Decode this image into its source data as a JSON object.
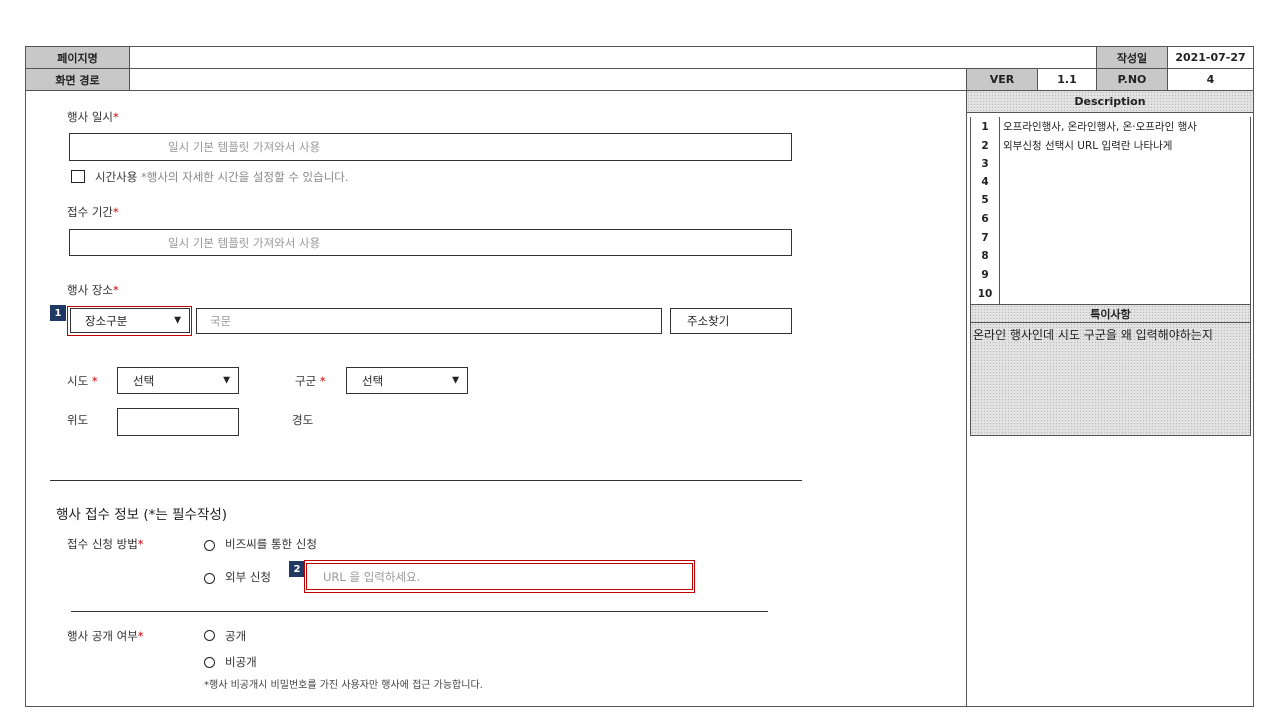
{
  "header": {
    "page_name_label": "페이지명",
    "page_name_value": "",
    "created_label": "작성일",
    "created_value": "2021-07-27",
    "path_label": "화면 경로",
    "path_value": "",
    "ver_label": "VER",
    "ver_value": "1.1",
    "pno_label": "P.NO",
    "pno_value": "4"
  },
  "form": {
    "event_date": {
      "label": "행사 일시",
      "required_mark": "*",
      "placeholder": "일시 기본 템플릿 가져와서 사용",
      "time_checkbox_label": "시간사용",
      "time_hint": "*행사의 자세한 시간을 설정할 수 있습니다."
    },
    "reception_period": {
      "label": "접수 기간",
      "required_mark": "*",
      "placeholder": "일시 기본 템플릿 가져와서 사용"
    },
    "venue": {
      "label": "행사 장소",
      "required_mark": "*",
      "place_type_select": "장소구분",
      "address_placeholder": "국문",
      "address_search_button": "주소찾기"
    },
    "sido": {
      "label": "시도",
      "required_mark": "*",
      "value": "선택"
    },
    "gugun": {
      "label": "구군",
      "required_mark": "*",
      "value": "선택"
    },
    "latitude": {
      "label": "위도",
      "value": ""
    },
    "longitude": {
      "label": "경도"
    },
    "reception_info": {
      "section_title": "행사 접수 정보 (*는 필수작성)",
      "method_label": "접수 신청 방법",
      "required_mark": "*",
      "option_bizzi": "비즈씨를 통한 신청",
      "option_external": "외부 신청",
      "url_placeholder": "URL 을 입력하세요."
    },
    "visibility": {
      "label": "행사 공개 여부",
      "required_mark": "*",
      "option_public": "공개",
      "option_private": "비공개",
      "private_hint": "*행사 비공개시 비밀번호를 가진 사용자만 행사에 접근 가능합니다."
    }
  },
  "badges": {
    "b1": "1",
    "b2": "2"
  },
  "description": {
    "title": "Description",
    "rows": [
      {
        "num": "1",
        "text": "오프라인행사, 온라인행사, 온·오프라인 행사"
      },
      {
        "num": "2",
        "text": "외부신청 선택시  URL 입력란 나타나게"
      },
      {
        "num": "3",
        "text": ""
      },
      {
        "num": "4",
        "text": ""
      },
      {
        "num": "5",
        "text": ""
      },
      {
        "num": "6",
        "text": ""
      },
      {
        "num": "7",
        "text": ""
      },
      {
        "num": "8",
        "text": ""
      },
      {
        "num": "9",
        "text": ""
      },
      {
        "num": "10",
        "text": ""
      }
    ],
    "notes_title": "특이사항",
    "notes_text": "온라인 행사인데 시도 구군을 왜 입력해야하는지"
  },
  "colors": {
    "badge": "#1f3864",
    "required": "#d40000",
    "highlight_border": "#c00000",
    "header_gray": "#c8c8c8"
  }
}
